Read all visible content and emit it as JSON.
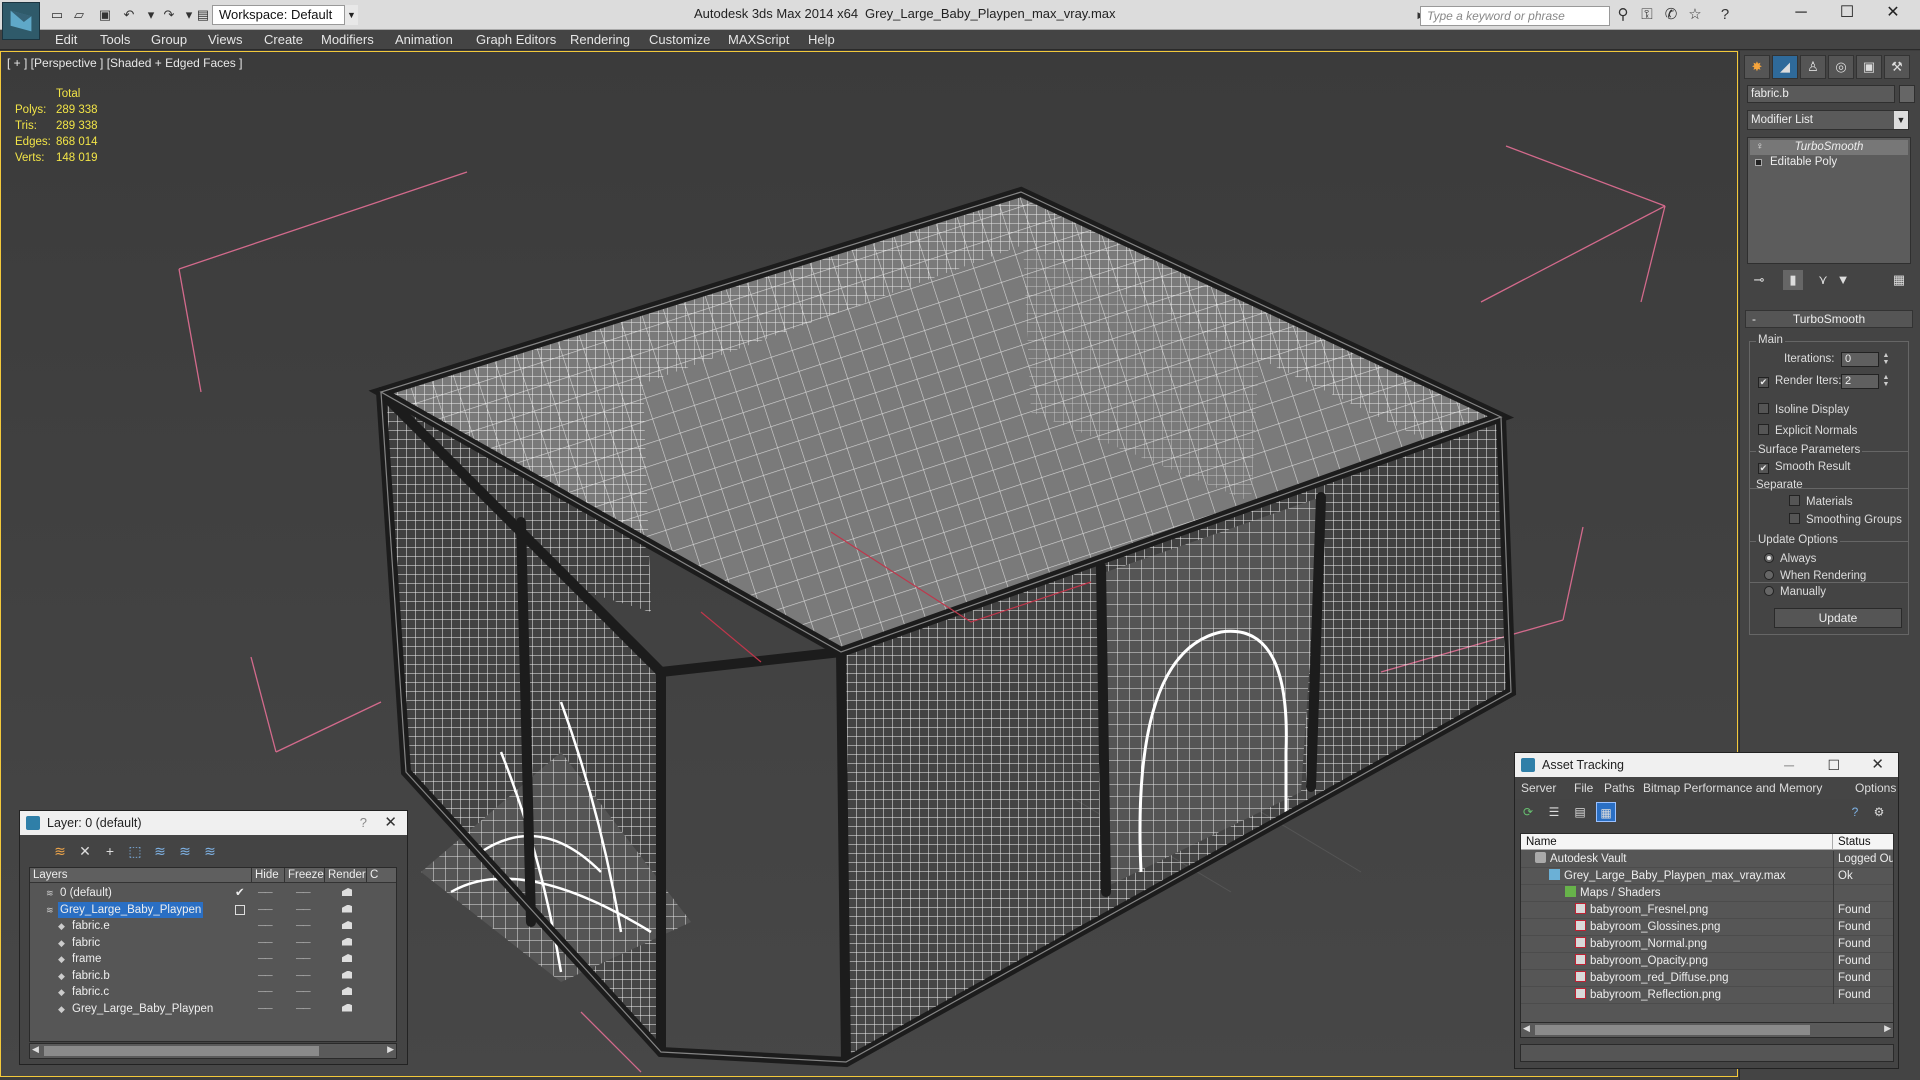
{
  "title_bar": {
    "workspace": "Workspace: Default",
    "app_name": "Autodesk 3ds Max  2014 x64",
    "file_name": "Grey_Large_Baby_Playpen_max_vray.max",
    "search_placeholder": "Type a keyword or phrase"
  },
  "menu": [
    "Edit",
    "Tools",
    "Group",
    "Views",
    "Create",
    "Modifiers",
    "Animation",
    "Graph Editors",
    "Rendering",
    "Customize",
    "MAXScript",
    "Help"
  ],
  "viewport": {
    "label": "[ + ] [Perspective ] [Shaded + Edged Faces ]",
    "stats_header": "Total",
    "stats": [
      {
        "label": "Polys:",
        "value": "289 338"
      },
      {
        "label": "Tris:",
        "value": "289 338"
      },
      {
        "label": "Edges:",
        "value": "868 014"
      },
      {
        "label": "Verts:",
        "value": "148 019"
      }
    ],
    "accent_color": "#f3c93b",
    "stats_color": "#f2e447"
  },
  "command_panel": {
    "object_name": "fabric.b",
    "modifier_list": "Modifier List",
    "stack": [
      "TurboSmooth",
      "Editable Poly"
    ],
    "rollout_title": "TurboSmooth",
    "main_label": "Main",
    "iterations_label": "Iterations:",
    "iterations_value": "0",
    "render_iters_label": "Render Iters:",
    "render_iters_value": "2",
    "isoline_display": "Isoline Display",
    "explicit_normals": "Explicit Normals",
    "surface_params_label": "Surface Parameters",
    "smooth_result": "Smooth Result",
    "separate_label": "Separate",
    "materials": "Materials",
    "smoothing_groups": "Smoothing Groups",
    "update_options_label": "Update Options",
    "always": "Always",
    "when_rendering": "When Rendering",
    "manually": "Manually",
    "update_button": "Update"
  },
  "layer_dialog": {
    "title": "Layer: 0 (default)",
    "help": "?",
    "columns": [
      "Layers",
      "Hide",
      "Freeze",
      "Render"
    ],
    "layers": [
      {
        "name": "0 (default)",
        "indent": 0,
        "selected": false
      },
      {
        "name": "Grey_Large_Baby_Playpen",
        "indent": 0,
        "selected": true
      },
      {
        "name": "fabric.e",
        "indent": 1,
        "selected": false
      },
      {
        "name": "fabric",
        "indent": 1,
        "selected": false
      },
      {
        "name": "frame",
        "indent": 1,
        "selected": false
      },
      {
        "name": "fabric.b",
        "indent": 1,
        "selected": false
      },
      {
        "name": "fabric.c",
        "indent": 1,
        "selected": false
      },
      {
        "name": "Grey_Large_Baby_Playpen",
        "indent": 1,
        "selected": false
      }
    ]
  },
  "asset_dialog": {
    "title": "Asset Tracking",
    "menu": [
      "Server",
      "File",
      "Paths",
      "Bitmap Performance and Memory",
      "Options"
    ],
    "columns": [
      "Name",
      "Status"
    ],
    "rows": [
      {
        "name": "Autodesk Vault",
        "status": "Logged Ou",
        "icon": "vault",
        "level": 0
      },
      {
        "name": "Grey_Large_Baby_Playpen_max_vray.max",
        "status": "Ok",
        "icon": "max",
        "level": 1
      },
      {
        "name": "Maps / Shaders",
        "status": "",
        "icon": "maps",
        "level": 2
      },
      {
        "name": "babyroom_Fresnel.png",
        "status": "Found",
        "icon": "png",
        "level": 3
      },
      {
        "name": "babyroom_Glossines.png",
        "status": "Found",
        "icon": "png",
        "level": 3
      },
      {
        "name": "babyroom_Normal.png",
        "status": "Found",
        "icon": "png",
        "level": 3
      },
      {
        "name": "babyroom_Opacity.png",
        "status": "Found",
        "icon": "png",
        "level": 3
      },
      {
        "name": "babyroom_red_Diffuse.png",
        "status": "Found",
        "icon": "png",
        "level": 3
      },
      {
        "name": "babyroom_Reflection.png",
        "status": "Found",
        "icon": "png",
        "level": 3
      }
    ]
  }
}
